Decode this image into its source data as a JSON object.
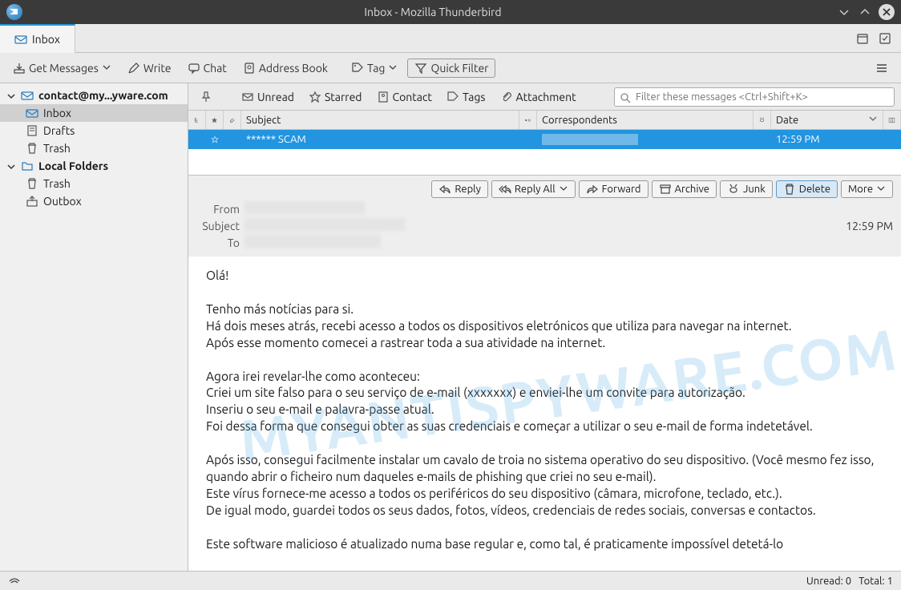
{
  "window": {
    "title": "Inbox - Mozilla Thunderbird"
  },
  "tab": {
    "label": "Inbox"
  },
  "toolbar": {
    "get_messages": "Get Messages",
    "write": "Write",
    "chat": "Chat",
    "address_book": "Address Book",
    "tag": "Tag",
    "quick_filter": "Quick Filter"
  },
  "sidebar": {
    "account": "contact@my...yware.com",
    "folders": {
      "inbox": "Inbox",
      "drafts": "Drafts",
      "trash": "Trash"
    },
    "local_label": "Local Folders",
    "local": {
      "trash": "Trash",
      "outbox": "Outbox"
    }
  },
  "filter": {
    "unread": "Unread",
    "starred": "Starred",
    "contact": "Contact",
    "tags": "Tags",
    "attachment": "Attachment",
    "search_placeholder": "Filter these messages <Ctrl+Shift+K>"
  },
  "columns": {
    "subject": "Subject",
    "correspondents": "Correspondents",
    "date": "Date"
  },
  "message_row": {
    "subject": "****** SCAM",
    "correspondent": "",
    "date": "12:59 PM"
  },
  "header": {
    "actions": {
      "reply": "Reply",
      "reply_all": "Reply All",
      "forward": "Forward",
      "archive": "Archive",
      "junk": "Junk",
      "delete": "Delete",
      "more": "More"
    },
    "from_label": "From",
    "subject_label": "Subject",
    "to_label": "To",
    "time": "12:59 PM"
  },
  "body": "Olá!\n\nTenho más notícias para si.\nHá dois meses atrás, recebi acesso a todos os dispositivos eletrónicos que utiliza para navegar na internet.\nApós esse momento comecei a rastrear toda a sua atividade na internet.\n\nAgora irei revelar-lhe como aconteceu:\nCriei um site falso para o seu serviço de e-mail (xxxxxxx) e enviei-lhe um convite para autorização.\nInseriu o seu e-mail e palavra-passe atual.\nFoi dessa forma que consegui obter as suas credenciais e começar a utilizar o seu e-mail de forma indetetável.\n\nApós isso, consegui facilmente instalar um cavalo de troia no sistema operativo do seu dispositivo. (Você mesmo fez isso, quando abrir o ficheiro num daqueles e-mails de phishing que criei no seu e-mail).\nEste vírus fornece-me acesso a todos os periféricos do seu dispositivo (câmara, microfone, teclado, etc.).\nDe igual modo, guardei todos os seus dados, fotos, vídeos, credenciais de redes sociais, conversas e contactos.\n\nEste software malicioso é atualizado numa base regular e, como tal, é praticamente impossível detetá-lo",
  "watermark": "MYANTISPYWARE.COM",
  "status": {
    "unread_label": "Unread:",
    "unread_count": "0",
    "total_label": "Total:",
    "total_count": "1"
  }
}
